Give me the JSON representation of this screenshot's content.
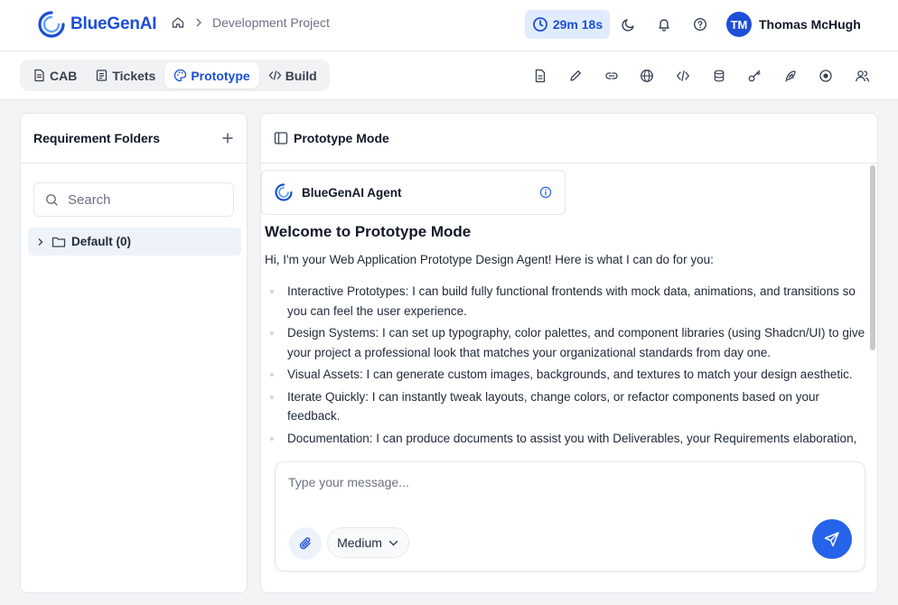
{
  "app": {
    "name": "BlueGenAI"
  },
  "breadcrumb": {
    "current": "Development Project"
  },
  "timer": {
    "value": "29m 18s"
  },
  "user": {
    "initials": "TM",
    "name": "Thomas McHugh"
  },
  "tabs": [
    {
      "label": "CAB",
      "icon": "document-icon"
    },
    {
      "label": "Tickets",
      "icon": "list-icon"
    },
    {
      "label": "Prototype",
      "icon": "palette-icon",
      "active": true
    },
    {
      "label": "Build",
      "icon": "code-icon"
    }
  ],
  "tools": [
    "document-icon",
    "pencil-icon",
    "link-icon",
    "globe-icon",
    "code-icon",
    "database-icon",
    "key-icon",
    "feather-icon",
    "record-icon",
    "users-icon"
  ],
  "folders": {
    "title": "Requirement Folders",
    "search_placeholder": "Search",
    "items": [
      {
        "label": "Default (0)"
      }
    ]
  },
  "main": {
    "title": "Prototype Mode",
    "agent": {
      "name": "BlueGenAI Agent"
    },
    "welcome_title": "Welcome to Prototype Mode",
    "intro": "Hi, I'm your Web Application Prototype Design Agent! Here is what I can do for you:",
    "features": [
      "Interactive Prototypes: I can build fully functional frontends with mock data, animations, and transitions so you can feel the user experience.",
      "Design Systems: I can set up typography, color palettes, and component libraries (using Shadcn/UI) to give your project a professional look that matches your organizational standards from day one.",
      "Visual Assets: I can generate custom images, backgrounds, and textures to match your design aesthetic.",
      "Iterate Quickly: I can instantly tweak layouts, change colors, or refactor components based on your feedback.",
      "Documentation: I can produce documents to assist you with Deliverables, your Requirements elaboration,"
    ]
  },
  "composer": {
    "placeholder": "Type your message...",
    "level": "Medium"
  },
  "colors": {
    "accent": "#1d4ed8",
    "send": "#2563eb"
  }
}
